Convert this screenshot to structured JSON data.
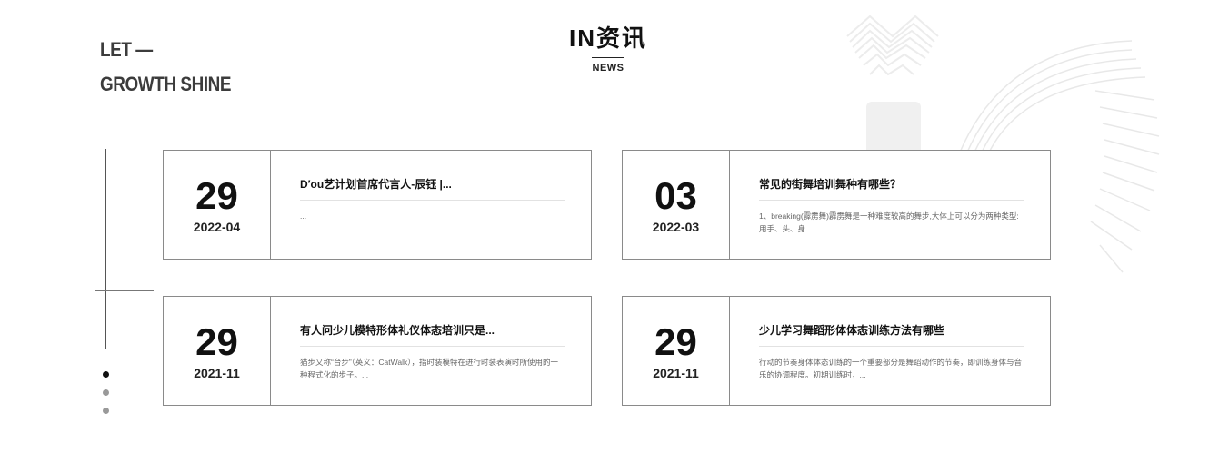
{
  "slogan": {
    "line1": "LET —",
    "line2": "GROWTH SHINE"
  },
  "section": {
    "title": "IN资讯",
    "subtitle": "NEWS"
  },
  "news": [
    {
      "day": "29",
      "ym": "2022-04",
      "title": "D′ou艺计划首席代言人-辰钰 |...",
      "excerpt": "..."
    },
    {
      "day": "03",
      "ym": "2022-03",
      "title": "常见的街舞培训舞种有哪些？",
      "excerpt": "1、breaking(霹雳舞)霹雳舞是一种难度较高的舞步,大体上可以分为两种类型:用手、头、身..."
    },
    {
      "day": "29",
      "ym": "2021-11",
      "title": "有人问少儿模特形体礼仪体态培训只是...",
      "excerpt": "猫步又称“台步”（英义：CatWalk），指时装模特在进行时装表演时所使用的一种程式化的步子。..."
    },
    {
      "day": "29",
      "ym": "2021-11",
      "title": "少儿学习舞蹈形体体态训练方法有哪些",
      "excerpt": "行动的节奏身体体态训练的一个重要部分是舞蹈动作的节奏，即训练身体与音乐的协调程度。初期训练时，..."
    }
  ],
  "pagination": {
    "total": 3,
    "active": 0
  },
  "colors": {
    "border": "#8a8a8a",
    "text": "#111111",
    "dot_active": "#111111",
    "dot_inactive": "#999999"
  }
}
